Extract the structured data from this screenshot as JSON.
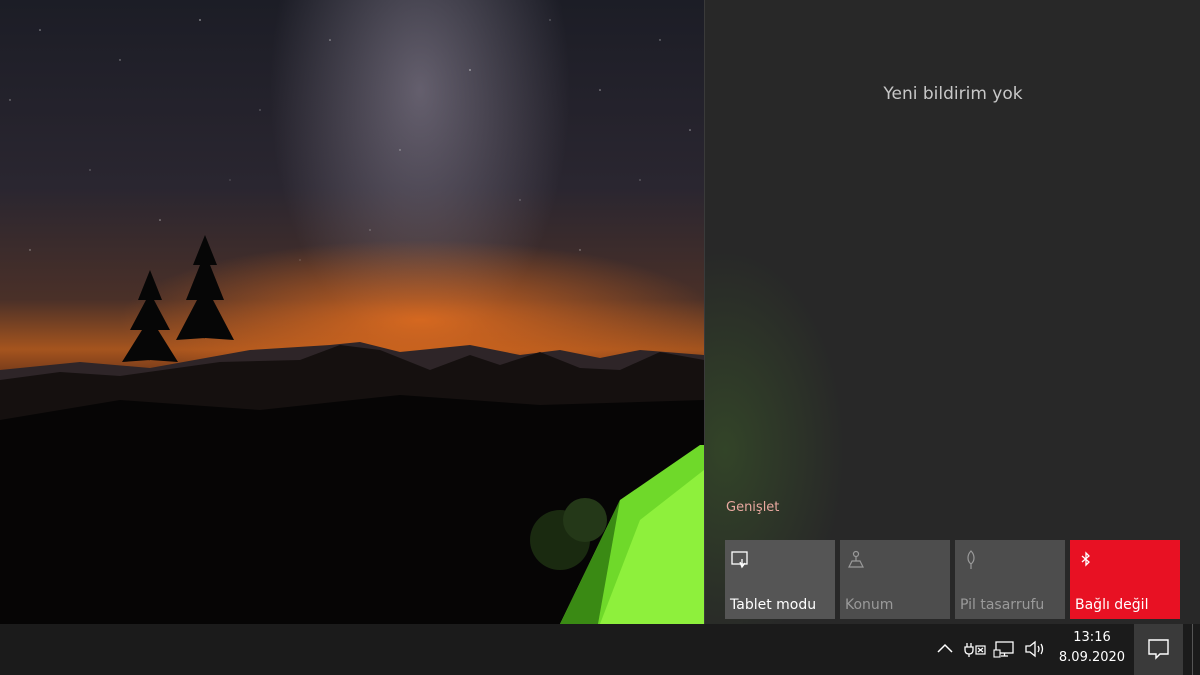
{
  "action_center": {
    "empty_message": "Yeni bildirim yok",
    "expand_label": "Genişlet",
    "quick_actions": [
      {
        "label": "Tablet modu",
        "icon": "tablet-mode-icon",
        "state": "off"
      },
      {
        "label": "Konum",
        "icon": "location-icon",
        "state": "disabled"
      },
      {
        "label": "Pil tasarrufu",
        "icon": "battery-saver-icon",
        "state": "disabled"
      },
      {
        "label": "Bağlı değil",
        "icon": "bluetooth-icon",
        "state": "on"
      }
    ]
  },
  "taskbar": {
    "time": "13:16",
    "date": "8.09.2020",
    "tray_icons": [
      "chevron-up-icon",
      "power-plug-icon",
      "network-icon",
      "volume-icon"
    ]
  },
  "colors": {
    "accent": "#e81123",
    "panel_bg": "#282828",
    "taskbar_bg": "#1b1b1b",
    "tile_bg": "#555555",
    "expand_link": "#e9a9a0"
  }
}
